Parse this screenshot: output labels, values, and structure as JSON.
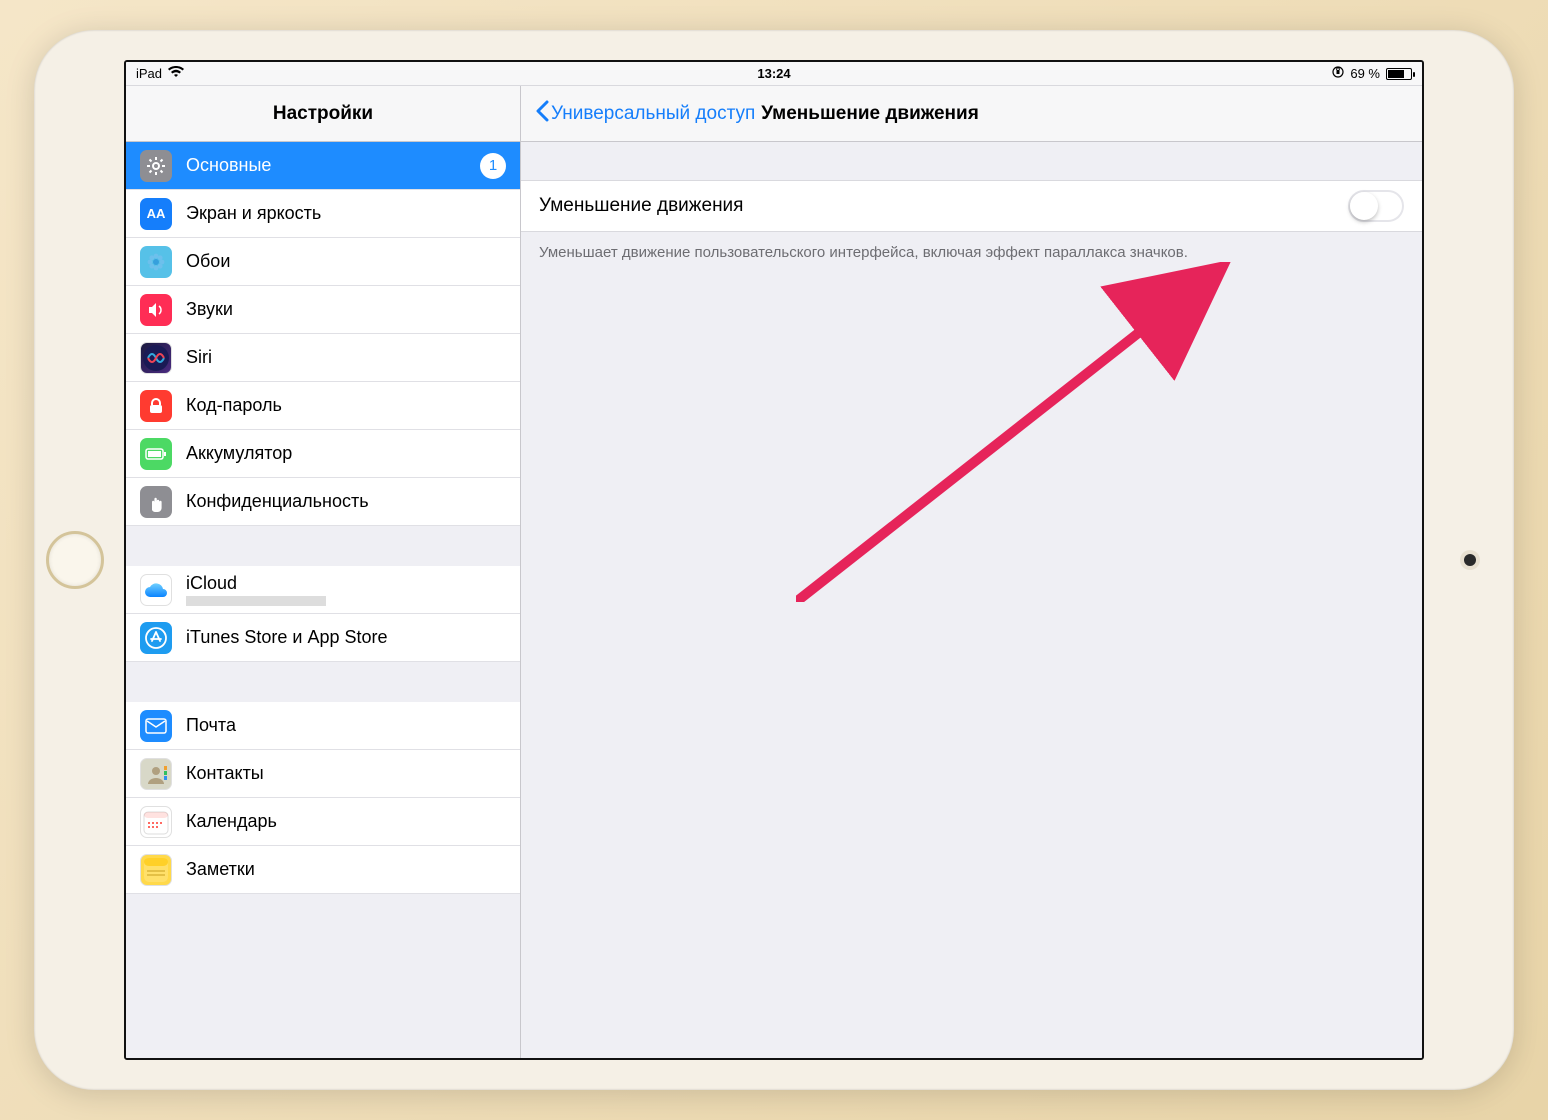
{
  "statusbar": {
    "device": "iPad",
    "time": "13:24",
    "battery_pct": "69 %"
  },
  "sidebar": {
    "title": "Настройки",
    "groups": [
      [
        {
          "id": "general",
          "label": "Основные",
          "icon": "gear",
          "bg": "#8e8e93",
          "badge": "1",
          "selected": true
        },
        {
          "id": "display",
          "label": "Экран и яркость",
          "icon": "AA",
          "bg": "#157efb"
        },
        {
          "id": "wallpaper",
          "label": "Обои",
          "icon": "flower",
          "bg": "#56c1e8"
        },
        {
          "id": "sounds",
          "label": "Звуки",
          "icon": "speaker",
          "bg": "#ff2d55"
        },
        {
          "id": "siri",
          "label": "Siri",
          "icon": "siri",
          "bg": "linear-gradient(135deg,#1a1a40,#4a2a80)"
        },
        {
          "id": "passcode",
          "label": "Код-пароль",
          "icon": "lock",
          "bg": "#ff3b30"
        },
        {
          "id": "battery",
          "label": "Аккумулятор",
          "icon": "battery",
          "bg": "#4cd964"
        },
        {
          "id": "privacy",
          "label": "Конфиденциальность",
          "icon": "hand",
          "bg": "#8e8e93"
        }
      ],
      [
        {
          "id": "icloud",
          "label": "iCloud",
          "icon": "cloud",
          "bg": "#fff",
          "sub_blur": true
        },
        {
          "id": "itunes",
          "label": "iTunes Store и App Store",
          "icon": "appstore",
          "bg": "#1e9cf0"
        }
      ],
      [
        {
          "id": "mail",
          "label": "Почта",
          "icon": "mail",
          "bg": "#1e8cff"
        },
        {
          "id": "contacts",
          "label": "Контакты",
          "icon": "contacts",
          "bg": "#d8d8c8"
        },
        {
          "id": "calendar",
          "label": "Календарь",
          "icon": "calendar",
          "bg": "#fff"
        },
        {
          "id": "notes",
          "label": "Заметки",
          "icon": "notes",
          "bg": "#ffd94a"
        }
      ]
    ]
  },
  "detail": {
    "back": "Универсальный доступ",
    "title": "Уменьшение движения",
    "toggle_label": "Уменьшение движения",
    "footer": "Уменьшает движение пользовательского интерфейса, включая эффект параллакса значков."
  }
}
